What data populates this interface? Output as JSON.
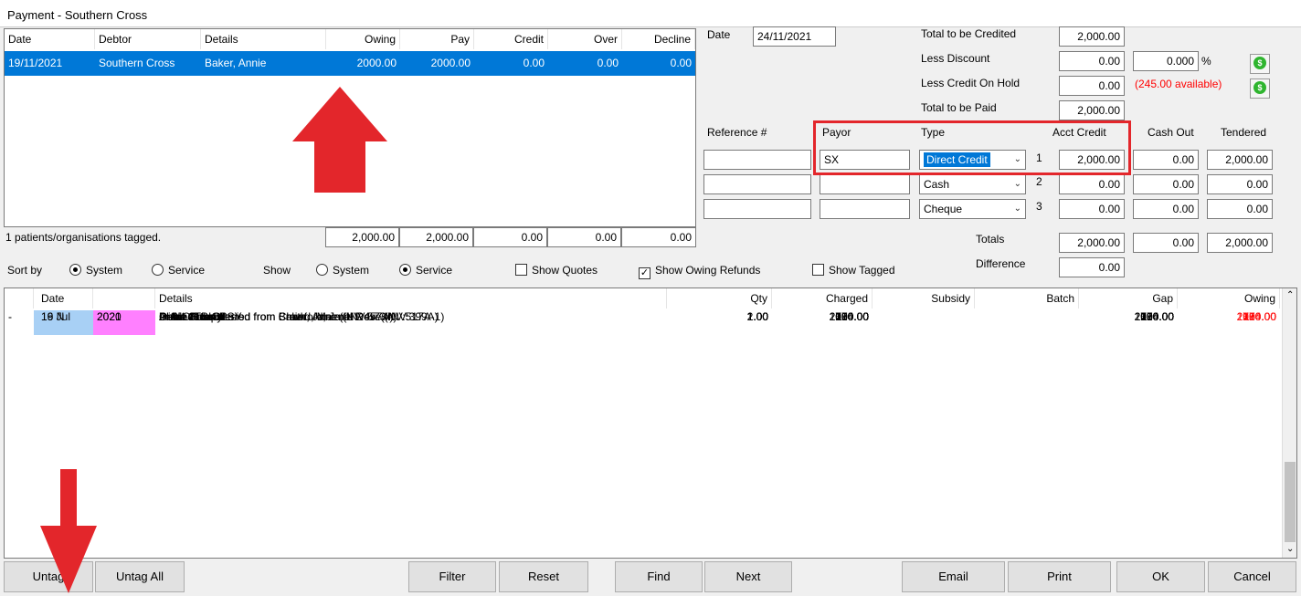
{
  "window": {
    "title": "Payment - Southern Cross"
  },
  "debtors": {
    "headers": [
      "Date",
      "Debtor",
      "Details",
      "Owing",
      "Pay",
      "Credit",
      "Over",
      "Decline"
    ],
    "rows": [
      {
        "date": "19/11/2021",
        "debtor": "Southern Cross",
        "details": "Baker, Annie",
        "owing": "2000.00",
        "pay": "2000.00",
        "credit": "0.00",
        "over": "0.00",
        "decline": "0.00"
      }
    ],
    "status": "1 patients/organisations tagged.",
    "totals": {
      "owing": "2,000.00",
      "pay": "2,000.00",
      "credit": "0.00",
      "over": "0.00",
      "decline": "0.00"
    }
  },
  "summary": {
    "date_label": "Date",
    "date": "24/11/2021",
    "total_credited_label": "Total to be Credited",
    "total_credited": "2,000.00",
    "less_discount_label": "Less Discount",
    "less_discount": "0.00",
    "discount_pct": "0.000",
    "pct_sign": "%",
    "less_credit_label": "Less Credit On Hold",
    "less_credit": "0.00",
    "available": "(245.00 available)",
    "total_paid_label": "Total to be Paid",
    "total_paid": "2,000.00"
  },
  "payment": {
    "headers": {
      "reference": "Reference #",
      "payor": "Payor",
      "type": "Type",
      "acct_credit": "Acct Credit",
      "cash_out": "Cash Out",
      "tendered": "Tendered"
    },
    "rows": [
      {
        "num": "1",
        "reference": "",
        "payor": "SX",
        "type": "Direct Credit",
        "acct_credit": "2,000.00",
        "cash_out": "0.00",
        "tendered": "2,000.00"
      },
      {
        "num": "2",
        "reference": "",
        "payor": "",
        "type": "Cash",
        "acct_credit": "0.00",
        "cash_out": "0.00",
        "tendered": "0.00"
      },
      {
        "num": "3",
        "reference": "",
        "payor": "",
        "type": "Cheque",
        "acct_credit": "0.00",
        "cash_out": "0.00",
        "tendered": "0.00"
      }
    ],
    "totals_label": "Totals",
    "totals": {
      "acct_credit": "2,000.00",
      "cash_out": "0.00",
      "tendered": "2,000.00"
    },
    "difference_label": "Difference",
    "difference": "0.00"
  },
  "options": {
    "sort_by_label": "Sort by",
    "sort_system": "System",
    "sort_service": "Service",
    "show_label": "Show",
    "show_system": "System",
    "show_service": "Service",
    "show_quotes": "Show Quotes",
    "show_owing_refunds": "Show Owing Refunds",
    "show_tagged": "Show Tagged"
  },
  "items": {
    "headers": [
      "Date",
      "Details",
      "Qty",
      "Charged",
      "Subsidy",
      "Batch",
      "Gap",
      "Owing"
    ],
    "rows": [
      {
        "style": "gray",
        "tag": "",
        "date": "",
        "year": "",
        "details": "Ankle Arthrodesis",
        "qty": "1.00",
        "charged": "1500.00",
        "gap": "1500.00",
        "owing": "1500.00"
      },
      {
        "style": "white",
        "tag": "-",
        "date": "29 Oct",
        "year": "2019",
        "details": "Debit - Transferred from Crawford, Jane Rose (INV:399A)",
        "qty": "1.00",
        "charged": "100.00",
        "gap": "100.00",
        "owing": "100.00"
      },
      {
        "style": "gray",
        "tag": "",
        "date": "",
        "year": "",
        "details": "Initial Consult",
        "qty": "1.00",
        "charged": "100.00",
        "gap": "100.00",
        "owing": "100.00"
      },
      {
        "style": "white",
        "tag": "-",
        "date": "14 May",
        "year": "2020",
        "details": "Debit - Transferred from Smith, Jane (INV:457A)",
        "qty": "1.00",
        "charged": "750.00",
        "gap": "750.00",
        "owing": "750.00"
      },
      {
        "style": "gray",
        "tag": "",
        "date": "",
        "year": "",
        "details": "Colonoscopy",
        "qty": "1.00",
        "charged": "750.00",
        "gap": "750.00",
        "owing": "750.00"
      },
      {
        "style": "white-bluedate",
        "tag": "-",
        "date": "16 Jul",
        "year": "2020",
        "details": "Debit - Transferred from Chand, Meenal Devi (INV:517A-1)",
        "qty": "2.00",
        "charged": "290.00",
        "gap": "290.00",
        "owing": "290.00"
      },
      {
        "style": "gray",
        "tag": "",
        "date": "",
        "year": "",
        "details": "Derm Consult",
        "qty": "1.00",
        "charged": "174.00",
        "gap": "174.00",
        "owing": "174.00"
      },
      {
        "style": "gray",
        "tag": "",
        "date": "",
        "year": "",
        "details": "PUNCH BIOPSY",
        "qty": "1.00",
        "charged": "116.00",
        "gap": "116.00",
        "owing": "116.00"
      },
      {
        "style": "selected",
        "tag": "-",
        "date": "19 N",
        "year": "2021",
        "details": "Debit - Transferred from Baker, Annie (INV:573A)",
        "qty": "1.00",
        "charged": "2000.00",
        "gap": "2000.00",
        "owing": "2000.00"
      },
      {
        "style": "yellow",
        "tag": "",
        "date": "",
        "year": "",
        "details": "Procedure One",
        "qty": "1.00",
        "charged": "2000.00",
        "gap": "2000.00",
        "owing": "2000.00"
      }
    ]
  },
  "buttons": {
    "untag": "Untag",
    "untag_all": "Untag All",
    "filter": "Filter",
    "reset": "Reset",
    "find": "Find",
    "next": "Next",
    "email": "Email",
    "print": "Print",
    "ok": "OK",
    "cancel": "Cancel"
  },
  "colors": {
    "selection": "#0078d7",
    "annotation_red": "#e3262b",
    "owing_red": "#ff0000",
    "year_pink": "#ff80ff",
    "row_gray": "#d9d9d9",
    "row_yellow": "#ffff00"
  }
}
